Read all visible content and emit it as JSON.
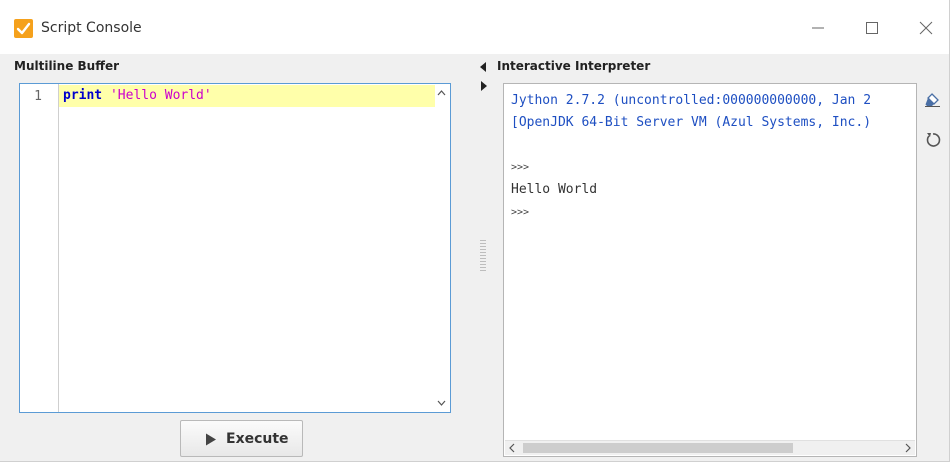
{
  "window": {
    "title": "Script Console"
  },
  "buffer": {
    "label": "Multiline Buffer",
    "line_numbers": [
      "1"
    ],
    "code": {
      "keyword": "print",
      "string": "'Hello World'"
    }
  },
  "execute": {
    "label": "Execute"
  },
  "interpreter": {
    "label": "Interactive Interpreter",
    "lines": [
      "Jython 2.7.2 (uncontrolled:000000000000, Jan 2",
      "[OpenJDK 64-Bit Server VM (Azul Systems, Inc.)"
    ],
    "prompt": ">>>",
    "output": "Hello World"
  },
  "colors": {
    "accent_border": "#5b9bd5",
    "current_line": "#ffffaa",
    "keyword": "#0000cc",
    "string": "#cc00cc",
    "banner_text": "#1e4fc2",
    "app_icon": "#f5a11c"
  },
  "icons": {
    "app": "script-console-icon",
    "clear": "eraser-icon",
    "reset": "reset-icon"
  }
}
